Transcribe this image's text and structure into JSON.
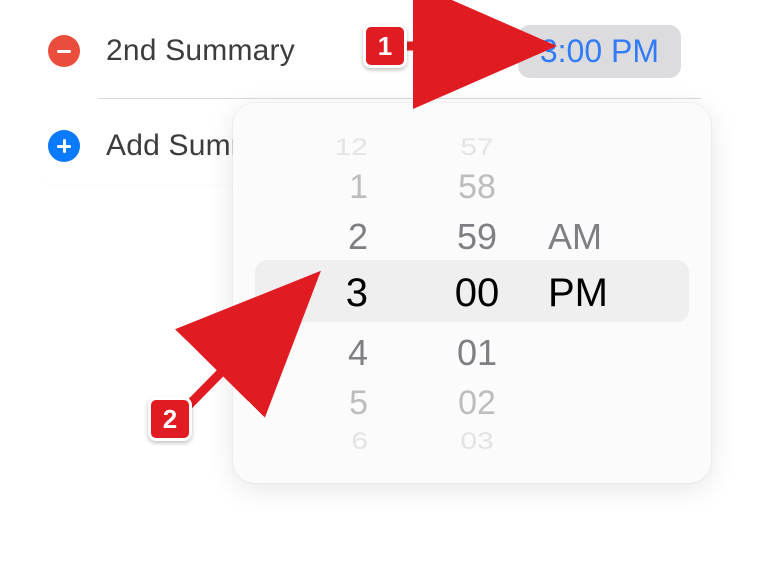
{
  "rows": {
    "summary2": {
      "label": "2nd Summary",
      "time": "3:00 PM"
    },
    "add": {
      "label": "Add Summ"
    }
  },
  "picker": {
    "hour": {
      "m3": "12",
      "m2": "1",
      "m1": "2",
      "sel": "3",
      "p1": "4",
      "p2": "5",
      "p3": "6"
    },
    "minute": {
      "m3": "57",
      "m2": "58",
      "m1": "59",
      "sel": "00",
      "p1": "01",
      "p2": "02",
      "p3": "03"
    },
    "ampm": {
      "m1": "AM",
      "sel": "PM"
    }
  },
  "callouts": {
    "one": "1",
    "two": "2"
  }
}
